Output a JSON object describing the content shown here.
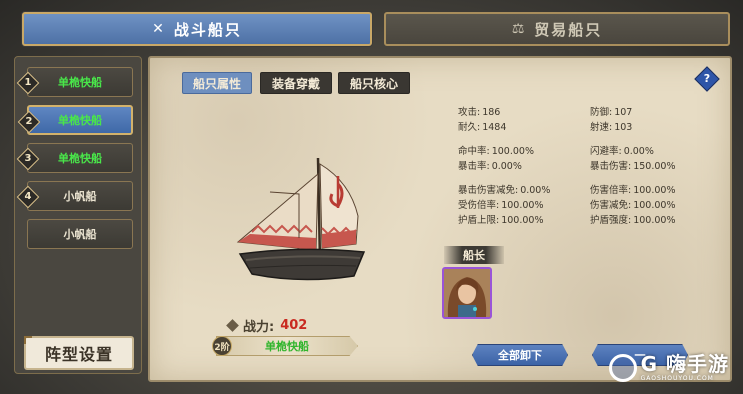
{
  "top_tabs": {
    "battle": {
      "label": "战斗船只",
      "icon": "crossed-swords-icon"
    },
    "trade": {
      "label": "贸易船只",
      "icon": "scales-icon"
    }
  },
  "sidebar": {
    "ships": [
      {
        "num": "1",
        "name": "单桅快船",
        "color": "green"
      },
      {
        "num": "2",
        "name": "单桅快船",
        "color": "green",
        "selected": true
      },
      {
        "num": "3",
        "name": "单桅快船",
        "color": "green"
      },
      {
        "num": "4",
        "name": "小帆船",
        "color": "white"
      },
      {
        "num": "",
        "name": "小帆船",
        "color": "white"
      }
    ],
    "formation_label": "阵型设置"
  },
  "sub_tabs": [
    "船只属性",
    "装备穿戴",
    "船只核心"
  ],
  "help_label": "?",
  "stats": {
    "attack": {
      "k": "攻击:",
      "v": "186"
    },
    "defense": {
      "k": "防御:",
      "v": "107"
    },
    "durability": {
      "k": "耐久:",
      "v": "1484"
    },
    "fire_rate": {
      "k": "射速:",
      "v": "103"
    },
    "hit_rate": {
      "k": "命中率:",
      "v": "100.00%"
    },
    "dodge_rate": {
      "k": "闪避率:",
      "v": "0.00%"
    },
    "crit_rate": {
      "k": "暴击率:",
      "v": "0.00%"
    },
    "crit_damage": {
      "k": "暴击伤害:",
      "v": "150.00%"
    },
    "crit_dmg_reduction": {
      "k": "暴击伤害减免:",
      "v": "0.00%"
    },
    "damage_multiplier": {
      "k": "伤害倍率:",
      "v": "100.00%"
    },
    "damage_taken_rate": {
      "k": "受伤倍率:",
      "v": "100.00%"
    },
    "damage_reduction": {
      "k": "伤害减免:",
      "v": "100.00%"
    },
    "shield_cap": {
      "k": "护盾上限:",
      "v": "100.00%"
    },
    "shield_strength": {
      "k": "护盾强度:",
      "v": "100.00%"
    }
  },
  "power": {
    "label": "战力:",
    "value": "402"
  },
  "tier": {
    "badge": "2阶",
    "ship_name": "单桅快船"
  },
  "captain": {
    "label": "船长"
  },
  "buttons": {
    "unload_all": "全部卸下",
    "partial": "一"
  },
  "watermark": {
    "main": "G 嗨手游",
    "sub": "GAOSHOUYOU.COM"
  },
  "colors": {
    "accent_blue": "#5f86c2",
    "ship_green": "#49e64a",
    "power_red": "#c92a20",
    "frame_gold": "#c9a867"
  }
}
